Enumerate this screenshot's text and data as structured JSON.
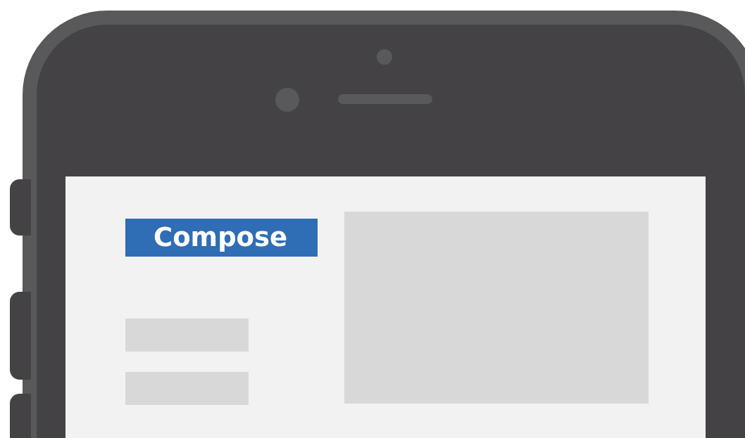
{
  "phone": {
    "screen": {
      "compose_button": {
        "label": "Compose"
      }
    }
  }
}
